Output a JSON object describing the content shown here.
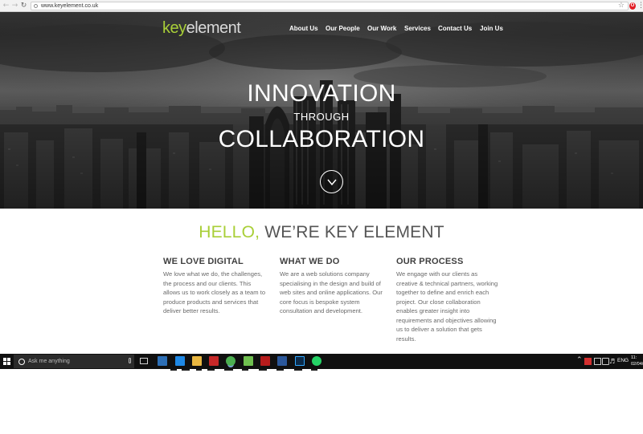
{
  "browser": {
    "url": "www.keyelement.co.uk",
    "icons": [
      "back-arrow-icon",
      "forward-arrow-icon",
      "reload-icon",
      "lock-icon",
      "star-icon",
      "opera-extension-icon",
      "menu-icon"
    ]
  },
  "site": {
    "logo_key": "key",
    "logo_element": "element",
    "nav": [
      "About Us",
      "Our People",
      "Our Work",
      "Services",
      "Contact Us",
      "Join Us"
    ],
    "accent_color": "#a9cf38"
  },
  "hero": {
    "line1": "INNOVATION",
    "line2": "THROUGH",
    "line3": "COLLABORATION"
  },
  "intro": {
    "hello": "HELLO,",
    "tagline": "WE’RE KEY ELEMENT",
    "columns": [
      {
        "title": "WE LOVE DIGITAL",
        "lines": [
          "We love what we do, the challenges,",
          "the process and our clients. This",
          "allows us to work closely as a team to",
          "produce products and services that",
          "deliver better results."
        ]
      },
      {
        "title": "WHAT WE DO",
        "lines": [
          "We are a web solutions company",
          "specialising in the design and build of",
          "web sites and online applications. Our",
          "core focus is bespoke system",
          "consultation and development."
        ]
      },
      {
        "title": "OUR PROCESS",
        "lines": [
          "We engage with our clients as",
          "creative & technical partners, working",
          "together to define and enrich each",
          "project. Our close collaboration",
          "enables greater insight into",
          "requirements and objectives allowing",
          "us to deliver a solution that gets",
          "results."
        ]
      }
    ]
  },
  "taskbar": {
    "search_placeholder": "Ask me anything",
    "language": "ENG",
    "clock_time": "11:",
    "clock_date": "02/04/",
    "apps": [
      "people-app-icon",
      "edge-icon",
      "file-explorer-icon",
      "acrobat-icon",
      "chrome-icon",
      "notepad-icon",
      "filezilla-icon",
      "word-icon",
      "photoshop-icon",
      "whatsapp-icon"
    ]
  }
}
